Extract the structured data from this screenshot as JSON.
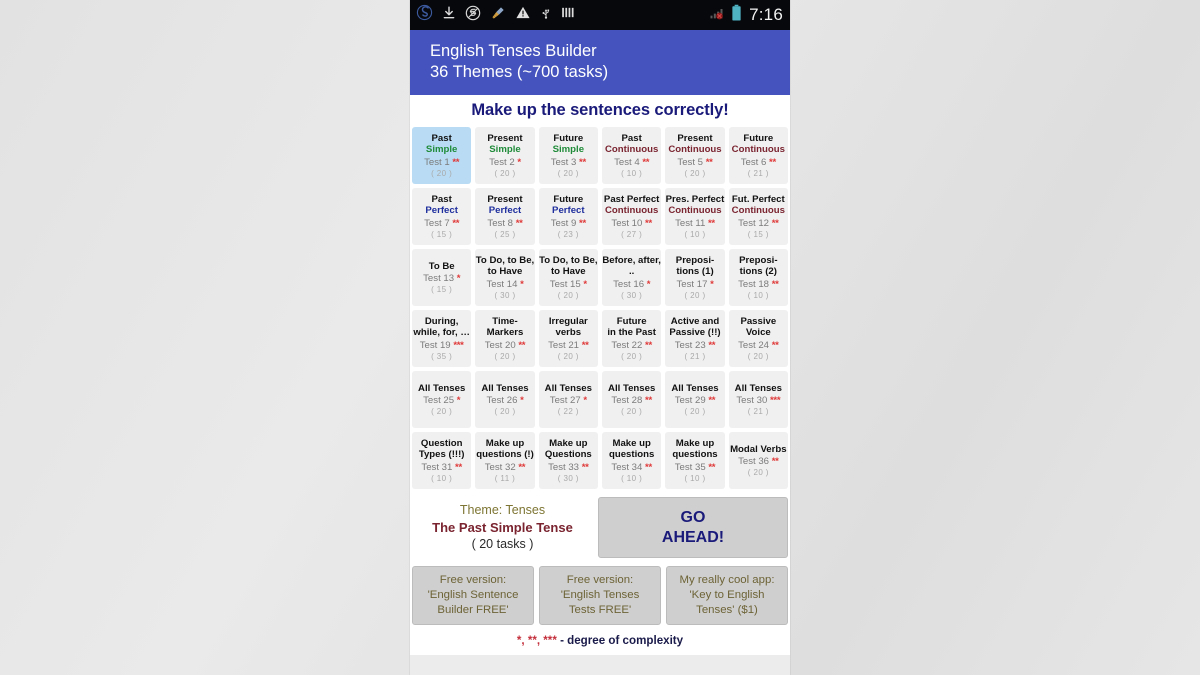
{
  "statusbar": {
    "icons": [
      "app-logo-icon",
      "download-icon",
      "sync-icon",
      "broom-icon",
      "warning-icon",
      "usb-icon",
      "bars-icon"
    ],
    "signal_icon": "signal-no-service-icon",
    "battery_icon": "battery-icon",
    "time": "7:16"
  },
  "header": {
    "title": "English Tenses Builder",
    "subtitle": "36 Themes (~700 tasks)",
    "bg_color": "#4453bd"
  },
  "main": {
    "instruction": "Make up the sentences correctly!"
  },
  "tiles": [
    {
      "line1": "Past",
      "line2": "Simple",
      "line2_color": "green",
      "test": "Test 1",
      "stars": "**",
      "count": "( 20 )",
      "selected": true
    },
    {
      "line1": "Present",
      "line2": "Simple",
      "line2_color": "green",
      "test": "Test 2",
      "stars": "*",
      "count": "( 20 )",
      "selected": false
    },
    {
      "line1": "Future",
      "line2": "Simple",
      "line2_color": "green",
      "test": "Test 3",
      "stars": "**",
      "count": "( 20 )",
      "selected": false
    },
    {
      "line1": "Past",
      "line2": "Continuous",
      "line2_color": "maroon",
      "test": "Test 4",
      "stars": "**",
      "count": "( 10 )",
      "selected": false
    },
    {
      "line1": "Present",
      "line2": "Continuous",
      "line2_color": "maroon",
      "test": "Test 5",
      "stars": "**",
      "count": "( 20 )",
      "selected": false
    },
    {
      "line1": "Future",
      "line2": "Continuous",
      "line2_color": "maroon",
      "test": "Test 6",
      "stars": "**",
      "count": "( 21 )",
      "selected": false
    },
    {
      "line1": "Past",
      "line2": "Perfect",
      "line2_color": "navy",
      "test": "Test 7",
      "stars": "**",
      "count": "( 15 )",
      "selected": false
    },
    {
      "line1": "Present",
      "line2": "Perfect",
      "line2_color": "navy",
      "test": "Test 8",
      "stars": "**",
      "count": "( 25 )",
      "selected": false
    },
    {
      "line1": "Future",
      "line2": "Perfect",
      "line2_color": "navy",
      "test": "Test 9",
      "stars": "**",
      "count": "( 23 )",
      "selected": false
    },
    {
      "line1": "Past Perfect",
      "line2": "Continuous",
      "line2_color": "maroon",
      "test": "Test 10",
      "stars": "**",
      "count": "( 27 )",
      "selected": false
    },
    {
      "line1": "Pres. Perfect",
      "line2": "Continuous",
      "line2_color": "maroon",
      "test": "Test 11",
      "stars": "**",
      "count": "( 10 )",
      "selected": false
    },
    {
      "line1": "Fut. Perfect",
      "line2": "Continuous",
      "line2_color": "maroon",
      "test": "Test 12",
      "stars": "**",
      "count": "( 15 )",
      "selected": false
    },
    {
      "line1": "To Be",
      "line2": "",
      "line2_color": "",
      "test": "Test 13",
      "stars": "*",
      "count": "( 15 )",
      "selected": false
    },
    {
      "line1": "To Do, to Be,",
      "line2": "to Have",
      "line2_color": "",
      "test": "Test 14",
      "stars": "*",
      "count": "( 30 )",
      "selected": false
    },
    {
      "line1": "To Do, to Be,",
      "line2": "to Have",
      "line2_color": "",
      "test": "Test 15",
      "stars": "*",
      "count": "( 20 )",
      "selected": false
    },
    {
      "line1": "Before, after,",
      "line2": "..",
      "line2_color": "",
      "test": "Test 16",
      "stars": "*",
      "count": "( 30 )",
      "selected": false
    },
    {
      "line1": "Preposi-",
      "line2": "tions (1)",
      "line2_color": "",
      "test": "Test 17",
      "stars": "*",
      "count": "( 20 )",
      "selected": false
    },
    {
      "line1": "Preposi-",
      "line2": "tions (2)",
      "line2_color": "",
      "test": "Test 18",
      "stars": "**",
      "count": "( 10 )",
      "selected": false
    },
    {
      "line1": "During,",
      "line2": "while, for, …",
      "line2_color": "",
      "test": "Test 19",
      "stars": "***",
      "count": "( 35 )",
      "selected": false
    },
    {
      "line1": "Time-",
      "line2": "Markers",
      "line2_color": "",
      "test": "Test 20",
      "stars": "**",
      "count": "( 20 )",
      "selected": false
    },
    {
      "line1": "Irregular",
      "line2": "verbs",
      "line2_color": "",
      "test": "Test 21",
      "stars": "**",
      "count": "( 20 )",
      "selected": false
    },
    {
      "line1": "Future",
      "line2": "in the Past",
      "line2_color": "",
      "test": "Test 22",
      "stars": "**",
      "count": "( 20 )",
      "selected": false
    },
    {
      "line1": "Active and",
      "line2": "Passive (!!)",
      "line2_color": "",
      "test": "Test 23",
      "stars": "**",
      "count": "( 21 )",
      "selected": false
    },
    {
      "line1": "Passive",
      "line2": "Voice",
      "line2_color": "",
      "test": "Test 24",
      "stars": "**",
      "count": "( 20 )",
      "selected": false
    },
    {
      "line1": "All Tenses",
      "line2": "",
      "line2_color": "",
      "test": "Test 25",
      "stars": "*",
      "count": "( 20 )",
      "selected": false
    },
    {
      "line1": "All Tenses",
      "line2": "",
      "line2_color": "",
      "test": "Test 26",
      "stars": "*",
      "count": "( 20 )",
      "selected": false
    },
    {
      "line1": "All Tenses",
      "line2": "",
      "line2_color": "",
      "test": "Test 27",
      "stars": "*",
      "count": "( 22 )",
      "selected": false
    },
    {
      "line1": "All Tenses",
      "line2": "",
      "line2_color": "",
      "test": "Test 28",
      "stars": "**",
      "count": "( 20 )",
      "selected": false
    },
    {
      "line1": "All Tenses",
      "line2": "",
      "line2_color": "",
      "test": "Test 29",
      "stars": "**",
      "count": "( 20 )",
      "selected": false
    },
    {
      "line1": "All Tenses",
      "line2": "",
      "line2_color": "",
      "test": "Test 30",
      "stars": "***",
      "count": "( 21 )",
      "selected": false
    },
    {
      "line1": "Question",
      "line2": "Types (!!!)",
      "line2_color": "",
      "test": "Test 31",
      "stars": "**",
      "count": "( 10 )",
      "selected": false
    },
    {
      "line1": "Make up",
      "line2": "questions (!)",
      "line2_color": "",
      "test": "Test 32",
      "stars": "**",
      "count": "( 11 )",
      "selected": false
    },
    {
      "line1": "Make up",
      "line2": "Questions",
      "line2_color": "",
      "test": "Test 33",
      "stars": "**",
      "count": "( 30 )",
      "selected": false
    },
    {
      "line1": "Make up",
      "line2": "questions",
      "line2_color": "",
      "test": "Test 34",
      "stars": "**",
      "count": "( 10 )",
      "selected": false
    },
    {
      "line1": "Make up",
      "line2": "questions",
      "line2_color": "",
      "test": "Test 35",
      "stars": "**",
      "count": "( 10 )",
      "selected": false
    },
    {
      "line1": "Modal Verbs",
      "line2": "",
      "line2_color": "",
      "test": "Test 36",
      "stars": "**",
      "count": "( 20 )",
      "selected": false
    }
  ],
  "theme": {
    "label": "Theme: Tenses",
    "name": "The Past Simple Tense",
    "tasks": "( 20 tasks )"
  },
  "go_button": {
    "line1": "GO",
    "line2": "AHEAD!"
  },
  "promos": [
    {
      "line1": "Free version:",
      "line2": "'English Sentence",
      "line3": "Builder FREE'"
    },
    {
      "line1": "Free version:",
      "line2": "'English Tenses",
      "line3": "Tests FREE'"
    },
    {
      "line1": "My really cool app:",
      "line2": "'Key to English",
      "line3": "Tenses' ($1)"
    }
  ],
  "legend": {
    "stars": "*, **, ***",
    "text": " - degree of complexity"
  }
}
